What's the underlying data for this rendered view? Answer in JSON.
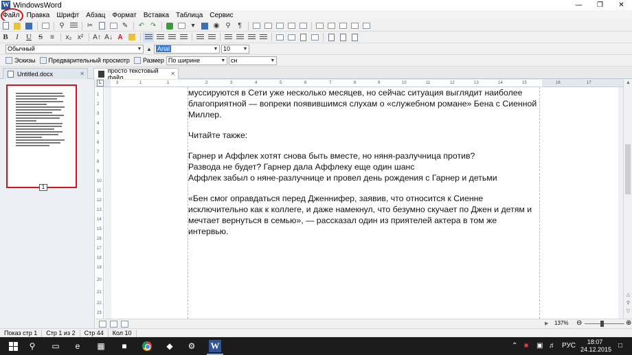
{
  "window": {
    "app_title": "WindowsWord",
    "logo_letter": "W"
  },
  "menu": [
    "Файл",
    "Правка",
    "Шрифт",
    "Абзац",
    "Формат",
    "Вставка",
    "Таблица",
    "Сервис"
  ],
  "formatting": {
    "style_value": "Обычный",
    "font_value": "Arial",
    "size_value": "10"
  },
  "view_toolbar": {
    "thumbnails_label": "Эскизы",
    "preview_label": "Предварительный просмотр",
    "size_label": "Размер",
    "size_value": "По ширине страницы",
    "extra_value": "сн"
  },
  "tabs": [
    {
      "label": "Untitled.docx"
    },
    {
      "label": "просто текстовый файл..."
    }
  ],
  "thumbnail": {
    "page_number": "1"
  },
  "ruler": {
    "h_ticks": [
      "3",
      "1",
      "1",
      "2",
      "3",
      "4",
      "5",
      "6",
      "7",
      "8",
      "9",
      "10",
      "11",
      "12",
      "13",
      "14",
      "15",
      "16",
      "17"
    ],
    "v_ticks": [
      "1",
      "2",
      "3",
      "4",
      "5",
      "6",
      "7",
      "8",
      "9",
      "10",
      "11",
      "12",
      "13",
      "14",
      "15",
      "16",
      "17",
      "18",
      "19",
      "20",
      "21",
      "22",
      "23"
    ]
  },
  "document": {
    "paragraphs": [
      [
        "муссируются в Сети уже несколько месяцев, но сейчас ситуация выглядит наиболее",
        "благоприятной — вопреки появившимся слухам о «служебном романе» Бена с Сиенной",
        "Миллер."
      ],
      [
        "Читайте также:"
      ],
      [
        "Гарнер и Аффлек хотят снова быть вместе, но няня-разлучница против?",
        "Развода не будет? Гарнер дала Аффлеку еще один шанс",
        "Аффлек забыл о няне-разлучнице и провел день рождения с Гарнер и детьми"
      ],
      [
        "«Бен смог оправдаться перед Дженнифер, заявив, что относится к Сиенне",
        "исключительно как к коллеге, и даже намекнул, что безумно скучает по Джен и детям и",
        "мечтает вернуться в семью», — рассказал один из приятелей актера в том же",
        "интервью."
      ]
    ]
  },
  "zoom": {
    "percent": "137%"
  },
  "status": {
    "mode": "Показ стр 1",
    "page_of": "Стр 1 из 2",
    "line": "Стр 44",
    "col": "Кол 10"
  },
  "taskbar": {
    "language": "РУС",
    "time": "18:07",
    "date": "24.12.2015"
  },
  "colors": {
    "highlight_ring": "#d0141a",
    "word_blue": "#2f5597"
  }
}
